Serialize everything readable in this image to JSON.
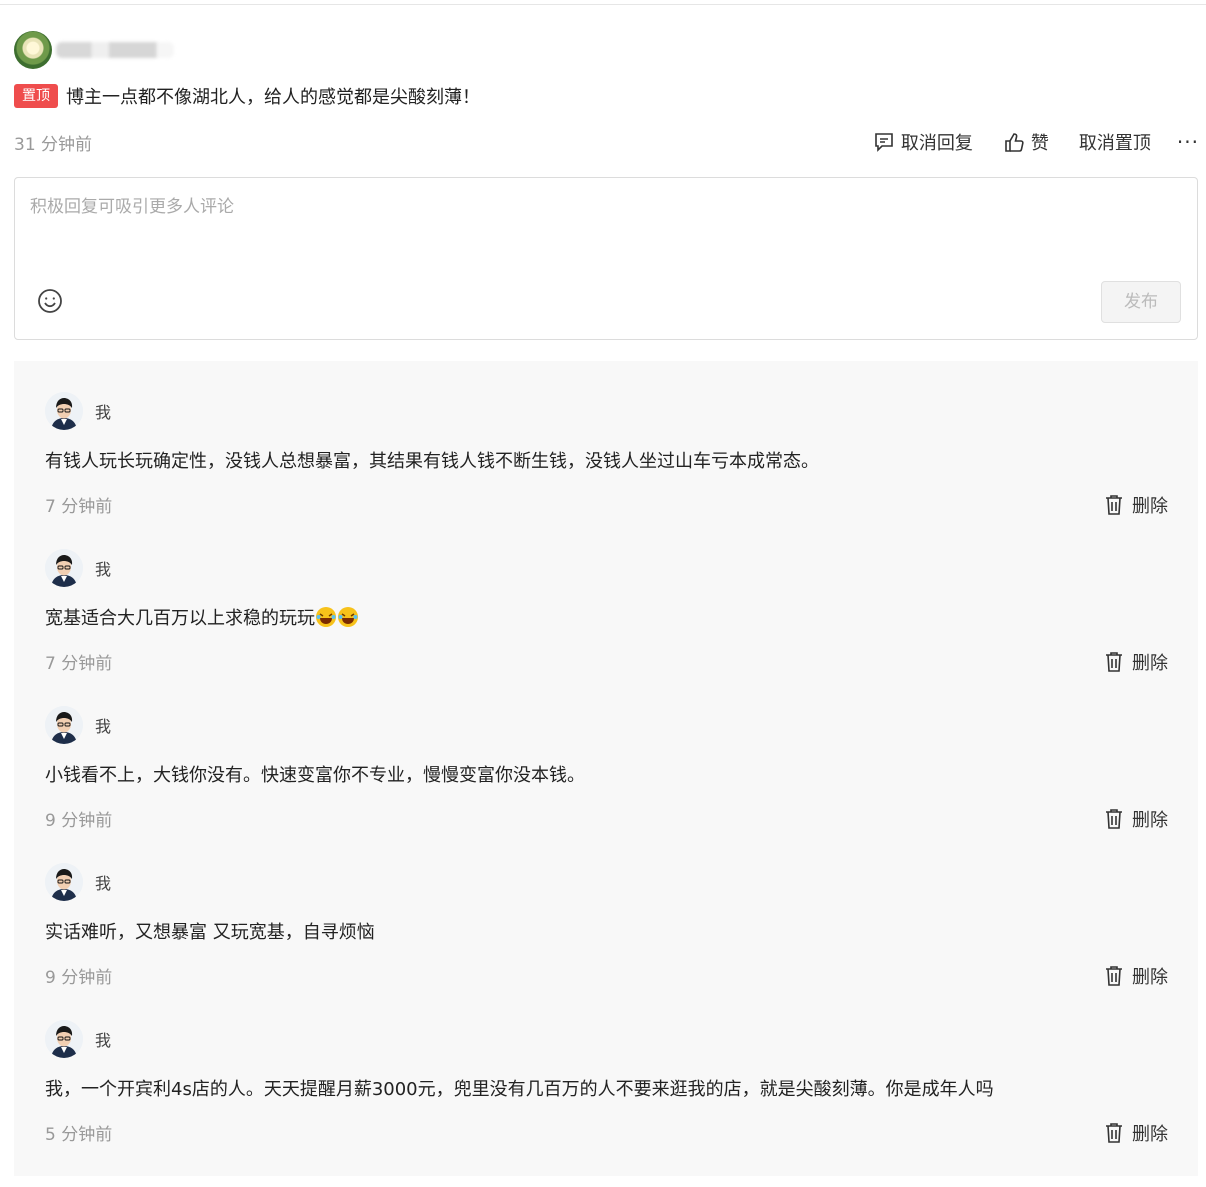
{
  "comment": {
    "pinned_badge": "置顶",
    "text": "博主一点都不像湖北人，给人的感觉都是尖酸刻薄！",
    "time": "31 分钟前",
    "actions": {
      "cancel_reply": "取消回复",
      "like": "赞",
      "unpin": "取消置顶",
      "more": "···"
    }
  },
  "reply_box": {
    "placeholder": "积极回复可吸引更多人评论",
    "emoji_icon": "smiley-icon",
    "publish": "发布"
  },
  "replies": [
    {
      "user": "我",
      "text": "有钱人玩长玩确定性，没钱人总想暴富，其结果有钱人钱不断生钱，没钱人坐过山车亏本成常态。",
      "time": "7 分钟前",
      "delete": "删除"
    },
    {
      "user": "我",
      "text": "宽基适合大几百万以上求稳的玩玩",
      "emojis": [
        "laughing-crying-emoji",
        "laughing-crying-emoji"
      ],
      "time": "7 分钟前",
      "delete": "删除"
    },
    {
      "user": "我",
      "text": "小钱看不上，大钱你没有。快速变富你不专业，慢慢变富你没本钱。",
      "time": "9 分钟前",
      "delete": "删除"
    },
    {
      "user": "我",
      "text": "实话难听，又想暴富 又玩宽基，自寻烦恼",
      "time": "9 分钟前",
      "delete": "删除"
    },
    {
      "user": "我",
      "text": "我，一个开宾利4s店的人。天天提醒月薪3000元，兜里没有几百万的人不要来逛我的店，就是尖酸刻薄。你是成年人吗",
      "time": "5 分钟前",
      "delete": "删除"
    }
  ],
  "colors": {
    "pin_badge": "#ef4d4d",
    "reply_area_bg": "#f8f8f8",
    "muted_text": "#999999"
  }
}
